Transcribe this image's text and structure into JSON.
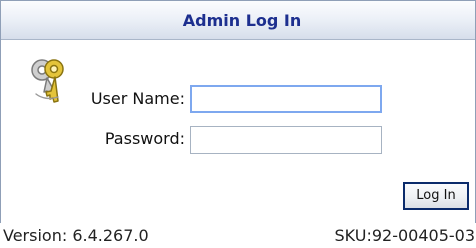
{
  "dialog": {
    "title": "Admin Log In",
    "icon": "keys-icon"
  },
  "form": {
    "username_label": "User Name:",
    "username_value": "",
    "password_label": "Password:",
    "password_value": ""
  },
  "actions": {
    "login_label": "Log In"
  },
  "footer": {
    "version": "Version: 6.4.267.0",
    "sku": "SKU:92-00405-03"
  },
  "colors": {
    "title_text": "#1d2f8f",
    "border": "#8f9fb7",
    "focus_border": "#7ea8ef"
  }
}
